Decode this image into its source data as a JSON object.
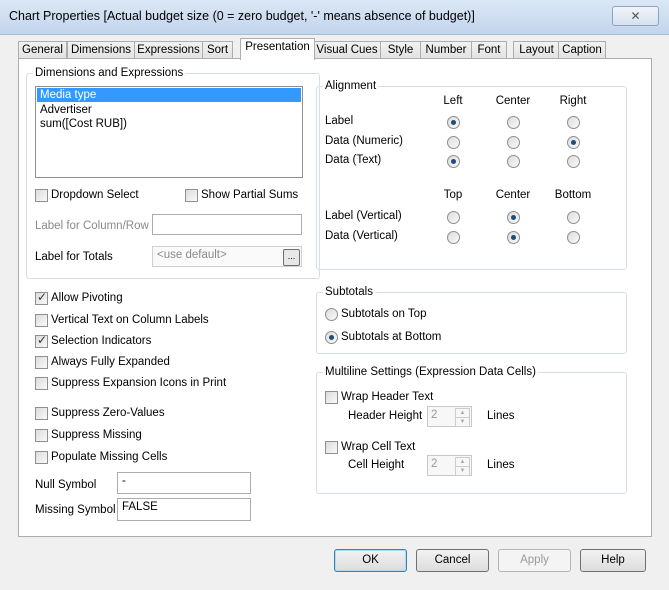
{
  "window": {
    "title": "Chart Properties [Actual budget size (0 = zero budget, '-' means absence of budget)]",
    "close": "✕"
  },
  "tabs": [
    "General",
    "Dimensions",
    "Expressions",
    "Sort",
    "Presentation",
    "Visual Cues",
    "Style",
    "Number",
    "Font",
    "Layout",
    "Caption"
  ],
  "active_tab": "Presentation",
  "dims": {
    "legend": "Dimensions and Expressions",
    "items": [
      "Media type",
      "Advertiser",
      "sum([Cost RUB])"
    ],
    "selected": "Media type",
    "dropdown_select": "Dropdown Select",
    "show_partial_sums": "Show Partial Sums",
    "label_col_row": "Label for Column/Row",
    "label_col_row_value": "",
    "label_totals": "Label for Totals",
    "label_totals_value": "<use default>",
    "ellipsis": "..."
  },
  "alignment": {
    "legend": "Alignment",
    "h_cols": [
      "Left",
      "Center",
      "Right"
    ],
    "h_rows": [
      {
        "label": "Label",
        "selected": "Left"
      },
      {
        "label": "Data (Numeric)",
        "selected": "Right"
      },
      {
        "label": "Data (Text)",
        "selected": "Left"
      }
    ],
    "v_cols": [
      "Top",
      "Center",
      "Bottom"
    ],
    "v_rows": [
      {
        "label": "Label (Vertical)",
        "selected": "Center"
      },
      {
        "label": "Data (Vertical)",
        "selected": "Center"
      }
    ]
  },
  "options": [
    {
      "label": "Allow Pivoting",
      "checked": true
    },
    {
      "label": "Vertical Text on Column Labels",
      "checked": false
    },
    {
      "label": "Selection Indicators",
      "checked": true
    },
    {
      "label": "Always Fully Expanded",
      "checked": false
    },
    {
      "label": "Suppress Expansion Icons in Print",
      "checked": false
    },
    {
      "label": "Suppress Zero-Values",
      "checked": false
    },
    {
      "label": "Suppress Missing",
      "checked": false
    },
    {
      "label": "Populate Missing Cells",
      "checked": false
    }
  ],
  "null_symbol": {
    "label": "Null Symbol",
    "value": "-"
  },
  "missing_symbol": {
    "label": "Missing Symbol",
    "value": "FALSE"
  },
  "subtotals": {
    "legend": "Subtotals",
    "on_top": "Subtotals on Top",
    "at_bottom": "Subtotals at Bottom",
    "selected": "at_bottom"
  },
  "multiline": {
    "legend": "Multiline Settings (Expression Data Cells)",
    "wrap_header": "Wrap Header Text",
    "header_height": "Header Height",
    "header_value": "2",
    "wrap_cell": "Wrap Cell Text",
    "cell_height": "Cell Height",
    "cell_value": "2",
    "lines": "Lines"
  },
  "buttons": {
    "ok": "OK",
    "cancel": "Cancel",
    "apply": "Apply",
    "help": "Help"
  }
}
